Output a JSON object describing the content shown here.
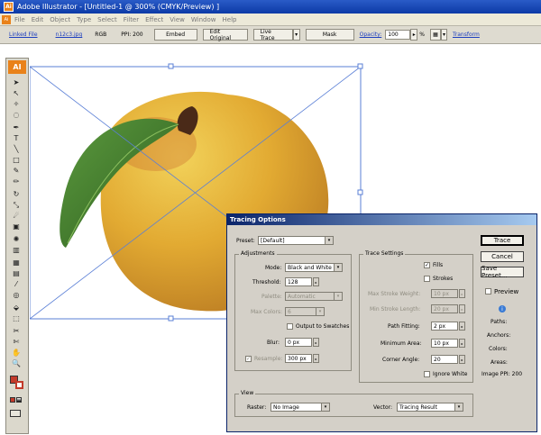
{
  "window": {
    "title": "Adobe Illustrator - [Untitled-1 @ 300% (CMYK/Preview) ]",
    "app_icon": "Ai"
  },
  "menu": [
    "File",
    "Edit",
    "Object",
    "Type",
    "Select",
    "Filter",
    "Effect",
    "View",
    "Window",
    "Help"
  ],
  "control_bar": {
    "linked_file": "Linked File",
    "file_name": "n12c3.jpg",
    "color_mode": "RGB",
    "ppi_label": "PPI: 200",
    "embed": "Embed",
    "edit_original": "Edit Original",
    "live_trace": "Live Trace",
    "mask": "Mask",
    "opacity_label": "Opacity:",
    "opacity_value": "100",
    "opacity_unit": "%",
    "transform": "Transform"
  },
  "toolbox": {
    "header": "AI"
  },
  "tracing_options": {
    "title": "Tracing Options",
    "preset_label": "Preset:",
    "preset_value": "[Default]",
    "adjustments": {
      "title": "Adjustments",
      "mode_label": "Mode:",
      "mode_value": "Black and White",
      "threshold_label": "Threshold:",
      "threshold_value": "128",
      "palette_label": "Palette:",
      "palette_value": "Automatic",
      "max_colors_label": "Max Colors:",
      "max_colors_value": "6",
      "output_swatches_label": "Output to Swatches",
      "blur_label": "Blur:",
      "blur_value": "0 px",
      "resample_label": "Resample:",
      "resample_value": "300 px"
    },
    "trace_settings": {
      "title": "Trace Settings",
      "fills_label": "Fills",
      "strokes_label": "Strokes",
      "max_stroke_weight_label": "Max Stroke Weight:",
      "max_stroke_weight_value": "10 px",
      "min_stroke_length_label": "Min Stroke Length:",
      "min_stroke_length_value": "20 px",
      "path_fitting_label": "Path Fitting:",
      "path_fitting_value": "2 px",
      "minimum_area_label": "Minimum Area:",
      "minimum_area_value": "10 px",
      "corner_angle_label": "Corner Angle:",
      "corner_angle_value": "20",
      "ignore_white_label": "Ignore White"
    },
    "view": {
      "title": "View",
      "raster_label": "Raster:",
      "raster_value": "No Image",
      "vector_label": "Vector:",
      "vector_value": "Tracing Result"
    },
    "buttons": {
      "trace": "Trace",
      "cancel": "Cancel",
      "save_preset": "Save Preset...",
      "preview": "Preview"
    },
    "info": {
      "paths": "Paths:",
      "anchors": "Anchors:",
      "colors": "Colors:",
      "areas": "Areas:",
      "image_ppi": "Image PPI: 200"
    }
  },
  "colors": {
    "dialog_bg": "#d4d0c8",
    "selection": "#5a7fd6",
    "peach": "#e8b23c",
    "leaf": "#3f7a2d"
  }
}
